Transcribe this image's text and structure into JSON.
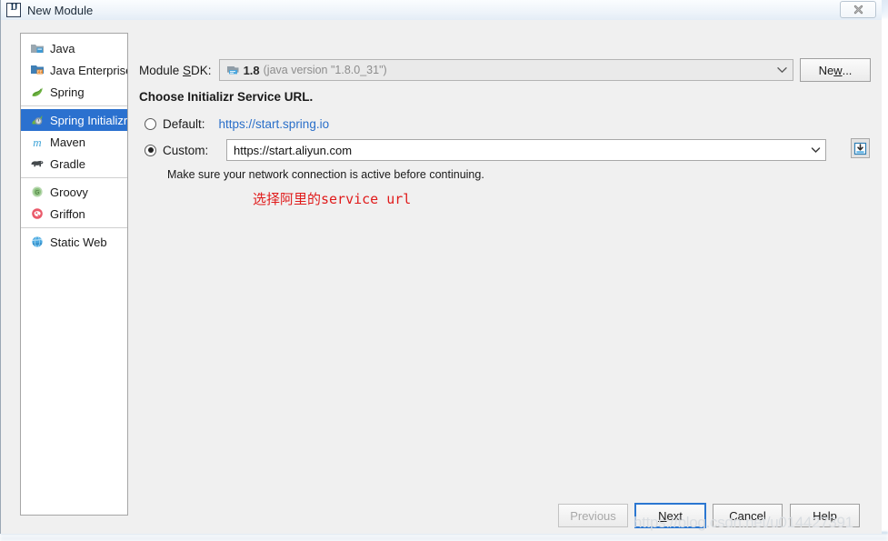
{
  "window": {
    "title": "New Module",
    "app_icon": "intellij-idea-icon",
    "close_label": "close-icon"
  },
  "sidebar": {
    "items": [
      {
        "label": "Java",
        "icon": "java-module-icon",
        "selected": false,
        "separator_after": false
      },
      {
        "label": "Java Enterprise",
        "icon": "java-ee-icon",
        "selected": false,
        "separator_after": false
      },
      {
        "label": "Spring",
        "icon": "spring-leaf-icon",
        "selected": false,
        "separator_after": true
      },
      {
        "label": "Spring Initializr",
        "icon": "spring-initializr-icon",
        "selected": true,
        "separator_after": false
      },
      {
        "label": "Maven",
        "icon": "maven-icon",
        "selected": false,
        "separator_after": false
      },
      {
        "label": "Gradle",
        "icon": "gradle-elephant-icon",
        "selected": false,
        "separator_after": true
      },
      {
        "label": "Groovy",
        "icon": "groovy-icon",
        "selected": false,
        "separator_after": false
      },
      {
        "label": "Griffon",
        "icon": "griffon-icon",
        "selected": false,
        "separator_after": true
      },
      {
        "label": "Static Web",
        "icon": "static-web-globe-icon",
        "selected": false,
        "separator_after": false
      }
    ]
  },
  "main": {
    "sdk": {
      "label_before": "Module ",
      "label_mnemonic": "S",
      "label_after": "DK:",
      "icon": "jdk-icon",
      "version": "1.8",
      "description": "(java version \"1.8.0_31\")",
      "dropdown_icon": "chevron-down-icon",
      "new_button_before": "Ne",
      "new_button_mnemonic": "w",
      "new_button_after": "..."
    },
    "section_title": "Choose Initializr Service URL.",
    "default_option": {
      "label": "Default:",
      "url": "https://start.spring.io",
      "selected": false
    },
    "custom_option": {
      "label": "Custom:",
      "value": "https://start.aliyun.com",
      "placeholder": "",
      "selected": true,
      "dropdown_icon": "chevron-down-icon",
      "import_button_icon": "import-download-icon"
    },
    "hint": "Make sure your network connection is active before continuing.",
    "annotation": "选择阿里的service url",
    "annotation_color": "#e01b1b"
  },
  "footer": {
    "previous": {
      "label": "Previous",
      "enabled": false
    },
    "next": {
      "before": "",
      "mnemonic": "N",
      "after": "ext",
      "focused": true
    },
    "cancel": {
      "label": "Cancel"
    },
    "help": {
      "label": "Help"
    }
  },
  "watermark": "https://blog.csdn.net/u014427391"
}
